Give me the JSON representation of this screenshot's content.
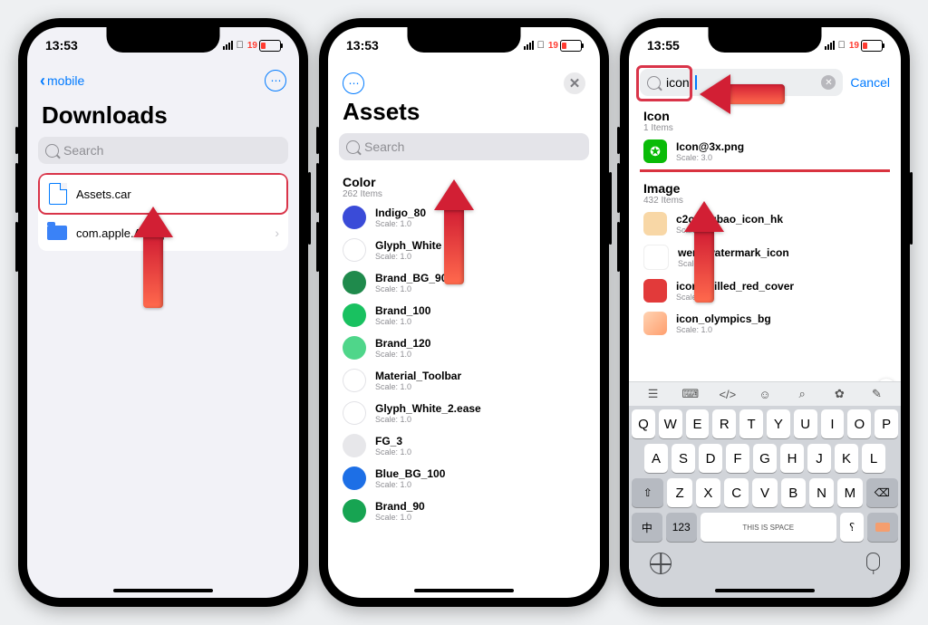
{
  "status": {
    "signal_icon": "signal-bars",
    "wifi_icon": "wifi",
    "battery_fill_color": "#ff3b30"
  },
  "phone1": {
    "time": "13:53",
    "battery": "19",
    "back_label": "mobile",
    "title": "Downloads",
    "search_placeholder": "Search",
    "rows": [
      {
        "name": "Assets.car",
        "icon": "file",
        "highlight": true
      },
      {
        "name": "com.apple.Air rop",
        "icon": "folder",
        "chevron": true
      }
    ]
  },
  "phone2": {
    "time": "13:53",
    "battery": "19",
    "title": "Assets",
    "search_placeholder": "Search",
    "section": {
      "title": "Color",
      "count": "262 Items"
    },
    "items": [
      {
        "name": "Indigo_80",
        "scale": "Scale: 1.0",
        "color": "#3a4bd8"
      },
      {
        "name": "Glyph_White",
        "scale": "Scale: 1.0",
        "color": "#ffffff"
      },
      {
        "name": "Brand_BG_90",
        "scale": "Scale: 1.0",
        "color": "#1f8a4c"
      },
      {
        "name": "Brand_100",
        "scale": "Scale: 1.0",
        "color": "#19c160"
      },
      {
        "name": "Brand_120",
        "scale": "Scale: 1.0",
        "color": "#4fd68a"
      },
      {
        "name": "Material_Toolbar",
        "scale": "Scale: 1.0",
        "color": "#ffffff"
      },
      {
        "name": "Glyph_White_2.ease",
        "scale": "Scale: 1.0",
        "color": "#ffffff"
      },
      {
        "name": "FG_3",
        "scale": "Scale: 1.0",
        "color": "#e7e7ea"
      },
      {
        "name": "Blue_BG_100",
        "scale": "Scale: 1.0",
        "color": "#1d6fe6"
      },
      {
        "name": "Brand_90",
        "scale": "Scale: 1.0",
        "color": "#17a452"
      }
    ]
  },
  "phone3": {
    "time": "13:55",
    "battery": "19",
    "search_value": "icon",
    "cancel": "Cancel",
    "sections": [
      {
        "title": "Icon",
        "count": "1 Items",
        "items": [
          {
            "name": "Icon@3x.png",
            "scale": "Scale: 3.0",
            "thumb": "wechat"
          }
        ]
      },
      {
        "title": "Image",
        "count": "432 Items",
        "items": [
          {
            "name": "c2c_h   gbao_icon_hk",
            "scale": "Scale: 1.0",
            "thumb": "red-env"
          },
          {
            "name": "weru   watermark_icon",
            "scale": "Scale: 1.0",
            "thumb": "blank"
          },
          {
            "name": "icons_filled_red_cover",
            "scale": "Scale: 1.0",
            "thumb": "red-cover"
          },
          {
            "name": "icon_olympics_bg",
            "scale": "Scale: 1.0",
            "thumb": "orange-grad"
          }
        ]
      }
    ],
    "keyboard": {
      "row1": [
        "Q",
        "W",
        "E",
        "R",
        "T",
        "Y",
        "U",
        "I",
        "O",
        "P"
      ],
      "row2": [
        "A",
        "S",
        "D",
        "F",
        "G",
        "H",
        "J",
        "K",
        "L"
      ],
      "row3_shift": "⇧",
      "row3": [
        "Z",
        "X",
        "C",
        "V",
        "B",
        "N",
        "M"
      ],
      "row3_del": "⌫",
      "row4_lang": "中",
      "row4_num": "123",
      "row4_space": "THIS IS SPACE",
      "row4_return_color": "#f59e6e"
    }
  }
}
